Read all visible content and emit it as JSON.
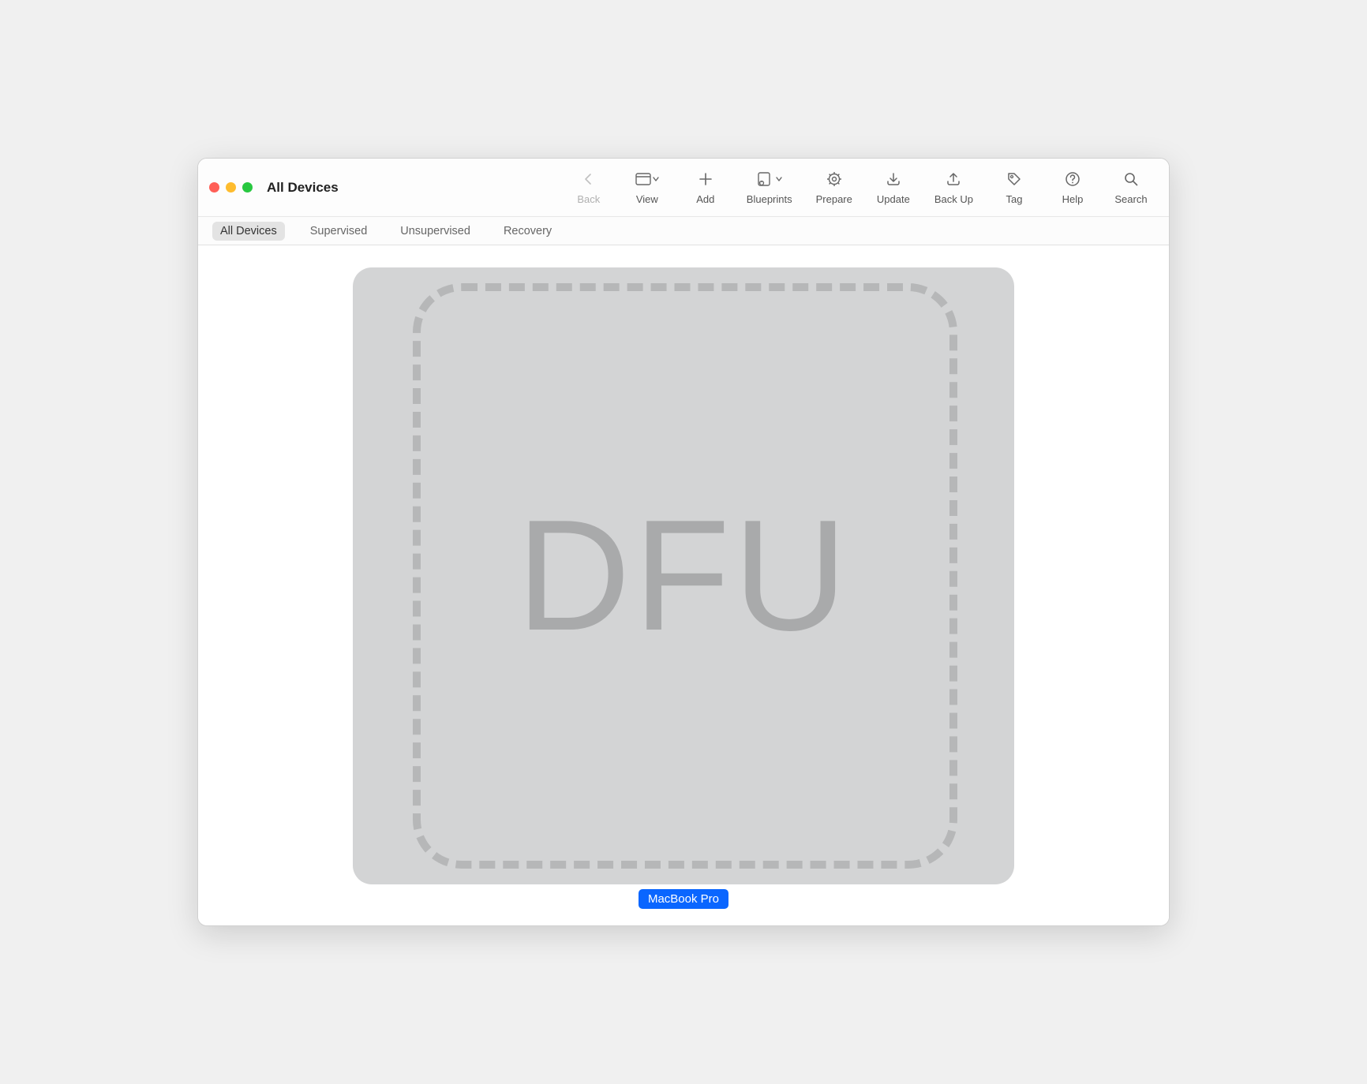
{
  "window": {
    "title": "All Devices"
  },
  "toolbar": {
    "back": "Back",
    "view": "View",
    "add": "Add",
    "blueprints": "Blueprints",
    "prepare": "Prepare",
    "update": "Update",
    "backup": "Back Up",
    "tag": "Tag",
    "help": "Help",
    "search": "Search"
  },
  "filter_tabs": {
    "all_devices": "All Devices",
    "supervised": "Supervised",
    "unsupervised": "Unsupervised",
    "recovery": "Recovery"
  },
  "device": {
    "mode_text": "DFU",
    "label": "MacBook Pro"
  }
}
